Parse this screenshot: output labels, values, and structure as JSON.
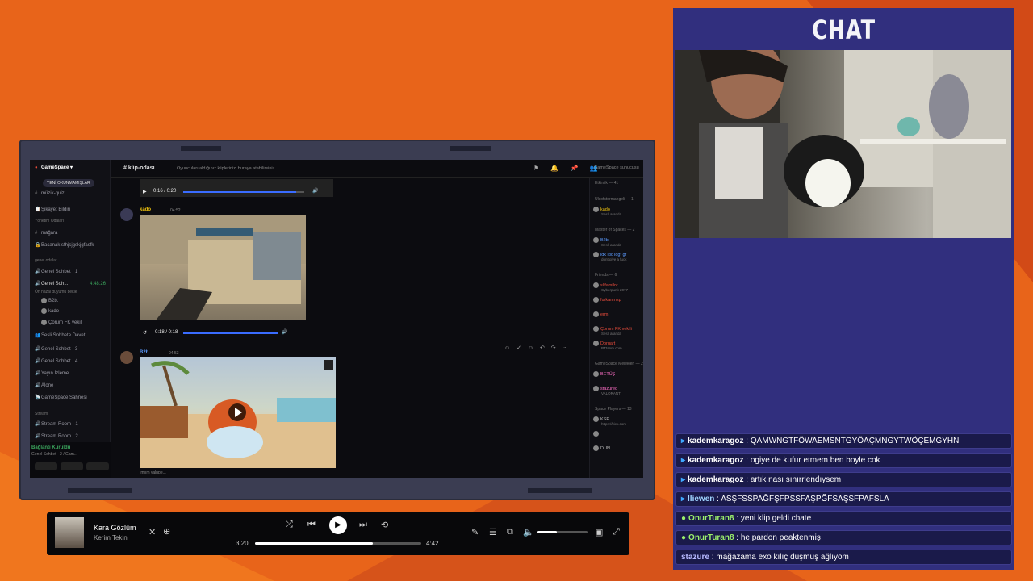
{
  "chat_panel": {
    "title": "CHAT",
    "messages": [
      {
        "user": "kademkaragoz",
        "text": "QAMWNGTFÖWAEMSNTGYÖAÇMNGYTWÖÇEMGYHN",
        "color": "#ffffff",
        "badge": "twitch"
      },
      {
        "user": "kademkaragoz",
        "text": "ogiye de kufur etmem ben boyle cok",
        "color": "#ffffff",
        "badge": "twitch"
      },
      {
        "user": "kademkaragoz",
        "text": "artık nası sınırrlendıysem",
        "color": "#ffffff",
        "badge": "twitch"
      },
      {
        "user": "lliewen",
        "text": "ASŞFSSPAĞFŞFPSSFAŞPĞFSAŞSFPAFSLA",
        "color": "#9fd4ff",
        "badge": "twitch"
      },
      {
        "user": "OnurTuran8",
        "text": "yeni klip geldi chate",
        "color": "#9bf06b",
        "badge": "kick"
      },
      {
        "user": "OnurTuran8",
        "text": "he pardon peaktenmiş",
        "color": "#9bf06b",
        "badge": "kick"
      },
      {
        "user": "stazure",
        "text": "mağazama exo kılıç düşmüş ağlıyom",
        "color": "#b7b9ff",
        "badge": ""
      }
    ]
  },
  "discord": {
    "server_name": "GameSpace",
    "sidebar": {
      "top_button": "YENİ OKUNMAMIŞLAR",
      "items": [
        {
          "label": "müzik-quiz",
          "icon": "#"
        },
        {
          "label": "Şikayet Bildiri",
          "icon": "📋"
        },
        {
          "label": "Yönetim Odaları",
          "icon": "",
          "head": true
        },
        {
          "label": "mağara",
          "icon": "#"
        },
        {
          "label": "Bacanak sfhjsjgskjgfasfk",
          "icon": "🔒"
        },
        {
          "label": "genel odalar",
          "icon": "",
          "head": true
        },
        {
          "label": "Genel Sohbet · 1",
          "icon": "🔊"
        },
        {
          "label": "Genel Soh...",
          "icon": "🔊",
          "active": true
        },
        {
          "label": "Ön hazal duyumu bekle",
          "icon": "",
          "head": true
        },
        {
          "label": "B2b.",
          "icon": "",
          "avatar": true
        },
        {
          "label": "kado",
          "icon": "",
          "avatar": true
        },
        {
          "label": "Çorum FK vekili",
          "icon": "",
          "avatar": true
        },
        {
          "label": "Sesli Sohbete Davet...",
          "icon": "👥"
        },
        {
          "label": "Genel Sohbet · 3",
          "icon": "🔊"
        },
        {
          "label": "Genel Sohbet · 4",
          "icon": "🔊"
        },
        {
          "label": "Yayın İzleme",
          "icon": "🔊"
        },
        {
          "label": "Alone",
          "icon": "🔊"
        },
        {
          "label": "GameSpace Sahnesi",
          "icon": "📡"
        },
        {
          "label": "Stream",
          "icon": "",
          "head": true
        },
        {
          "label": "Stream Room · 1",
          "icon": "🔊"
        },
        {
          "label": "Stream Room · 2",
          "icon": "🔊"
        }
      ],
      "call_time": "4:48:26",
      "status_title": "Bağlantı Kuruldu",
      "status_sub": "Genel Sohbet · 2 / Gam..."
    },
    "channel": {
      "name": "klip-odası",
      "topic": "Oyuncuları aldığınız kliplerinizi buraya atabilirsiniz"
    },
    "messages": [
      {
        "author": "kado",
        "tag": "GS",
        "time": "04:52",
        "color": "#f1c40f",
        "video_time": "0:18 / 0:18"
      },
      {
        "author": "B2b.",
        "tag": "GS",
        "time": "04:53",
        "color": "#5c9bff"
      }
    ],
    "top_video_time": "0:16 / 0:20",
    "members_header": "GameSpace sunucusu",
    "member_groups": [
      {
        "label": "Etkinlik — 41",
        "items": []
      },
      {
        "label": "Ulsofstormangeli — 1",
        "items": [
          {
            "name": "kado",
            "sub": "Sesli aranda",
            "color": "#f1c40f"
          }
        ]
      },
      {
        "label": "Master of Spaces — 2",
        "items": [
          {
            "name": "B2b.",
            "sub": "Sesli aranda",
            "color": "#5c9bff"
          },
          {
            "name": "idk idc ldgf gf",
            "sub": "dont give a fuck",
            "color": "#5c9bff"
          }
        ]
      },
      {
        "label": "Friends — 6",
        "items": [
          {
            "name": "slifamilor",
            "sub": "Cyberpunk 2077",
            "color": "#e74c3c"
          },
          {
            "name": "furkanmsp",
            "sub": "",
            "color": "#e74c3c"
          },
          {
            "name": "erm",
            "sub": "",
            "color": "#e74c3c"
          },
          {
            "name": "Çorum FK vekili",
            "sub": "Sesli aranda",
            "color": "#e74c3c"
          },
          {
            "name": "Doruart",
            "sub": "RTtanm.com",
            "color": "#e74c3c"
          }
        ]
      },
      {
        "label": "GameSpace Melekleri — 2",
        "items": [
          {
            "name": "BETÜŞ",
            "sub": "",
            "color": "#ff6ec7"
          },
          {
            "name": "stazurec",
            "sub": "VALORANT",
            "color": "#ff6ec7"
          }
        ]
      },
      {
        "label": "Space Players — 13",
        "items": [
          {
            "name": "KSP",
            "sub": "https://kick.com",
            "color": "#bbb"
          },
          {
            "name": "",
            "sub": "",
            "color": "#bbb"
          },
          {
            "name": "DUN",
            "sub": "",
            "color": "#bbb"
          }
        ]
      }
    ],
    "input_preview": "Imıım yalnpe..."
  },
  "player": {
    "title": "Kara Gözlüm",
    "artist": "Kerim Tekin",
    "current_time": "3:20",
    "total_time": "4:42",
    "progress": 0.71,
    "volume": 0.38
  },
  "colors": {
    "background": "#e8641a",
    "chat_bg": "#312f7e",
    "discord_bg": "#0c0c10"
  }
}
